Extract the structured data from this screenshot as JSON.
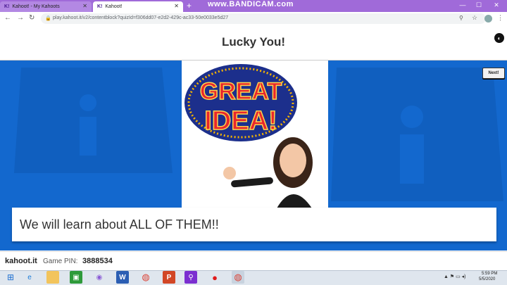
{
  "browser": {
    "tabs": [
      {
        "favicon": "K!",
        "label": "Kahoot! - My Kahoots"
      },
      {
        "favicon": "K!",
        "label": "Kahoot!"
      }
    ],
    "new_tab": "+",
    "url": "play.kahoot.it/v2/contentblock?quizId=f306dd07-e2d2-429c-ac33-50e0033e5d27",
    "watermark": "www.BANDICAM.com"
  },
  "page": {
    "title": "Lucky You!",
    "next_label": "Next!",
    "caption": "We will learn about ALL OF THEM!!",
    "image_text": "GREAT IDEA!"
  },
  "footer": {
    "brand": "kahoot.it",
    "pin_label": "Game PIN:",
    "pin_value": "3888534"
  },
  "taskbar": {
    "time": "5:59 PM",
    "date": "5/5/2020"
  },
  "colors": {
    "stage": "#1368ce",
    "tabstrip": "#a06ad9"
  }
}
